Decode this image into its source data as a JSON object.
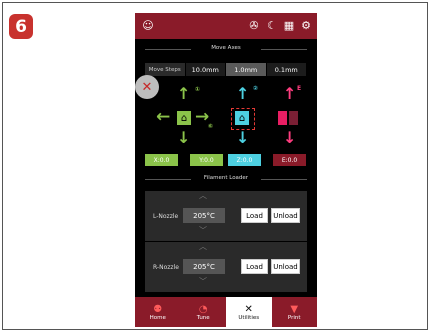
{
  "badge": "6",
  "topbar": {
    "icons": [
      "robot-icon",
      "fan-icon",
      "moon-icon",
      "grid-icon",
      "gear-icon"
    ]
  },
  "move_axes": {
    "title": "Move Axes",
    "steps_label": "Move Steps",
    "steps": [
      "10.0mm",
      "1.0mm",
      "0.1mm"
    ],
    "active_step": "1.0mm",
    "markers": {
      "y": "①",
      "x": "⑥",
      "z": "②",
      "e": "E"
    },
    "coords": {
      "x": "X:0.0",
      "y": "Y:0.0",
      "z": "Z:0.0",
      "e": "E:0.0"
    },
    "colors": {
      "x": "#8bc34a",
      "y": "#8bc34a",
      "z": "#4dd0e1",
      "e": "#ff3d7f"
    }
  },
  "filament_loader": {
    "title": "Filament Loader",
    "nozzles": [
      {
        "label": "L-Nozzle",
        "temp": "205°C",
        "load": "Load",
        "unload": "Unload"
      },
      {
        "label": "R-Nozzle",
        "temp": "205°C",
        "load": "Load",
        "unload": "Unload"
      }
    ]
  },
  "nav": {
    "items": [
      {
        "label": "Home",
        "icon": "people-icon"
      },
      {
        "label": "Tune",
        "icon": "gauge-icon"
      },
      {
        "label": "Utilities",
        "icon": "tools-icon",
        "active": true
      },
      {
        "label": "Print",
        "icon": "print-icon"
      }
    ]
  }
}
